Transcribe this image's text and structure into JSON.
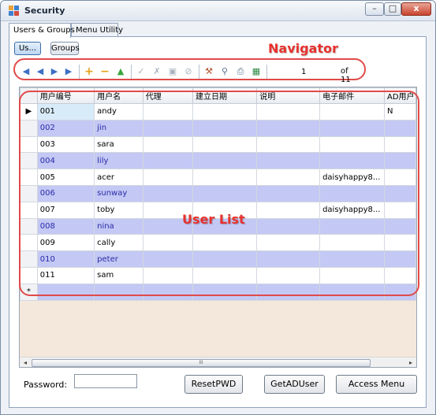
{
  "window": {
    "title": "Security",
    "min_label": "–",
    "max_label": "□",
    "close_label": "x"
  },
  "tabs": [
    {
      "label": "Users & Groups",
      "active": true
    },
    {
      "label": "Menu Utility",
      "active": false
    }
  ],
  "subtabs": [
    {
      "label": "Us...",
      "active": true
    },
    {
      "label": "Groups",
      "active": false
    }
  ],
  "annotations": {
    "navigator": "Navigator",
    "user_list": "User List"
  },
  "navigator": {
    "icons": [
      "first-icon",
      "prev-icon",
      "next-icon",
      "last-icon",
      "add-icon",
      "delete-icon",
      "up-icon",
      "check-icon",
      "cancel-icon",
      "save-icon",
      "stop-icon",
      "tool-icon",
      "find-icon",
      "print-icon",
      "export-icon"
    ],
    "position": "1",
    "of_label": "of 11"
  },
  "grid": {
    "columns": [
      "用户编号",
      "用户名",
      "代理",
      "建立日期",
      "说明",
      "电子邮件",
      "AD用户"
    ],
    "rows": [
      [
        "001",
        "andy",
        "",
        "",
        "",
        "",
        "N"
      ],
      [
        "002",
        "jin",
        "",
        "",
        "",
        "",
        ""
      ],
      [
        "003",
        "sara",
        "",
        "",
        "",
        "",
        ""
      ],
      [
        "004",
        "lily",
        "",
        "",
        "",
        "",
        ""
      ],
      [
        "005",
        "acer",
        "",
        "",
        "",
        "daisyhappy8...",
        ""
      ],
      [
        "006",
        "sunway",
        "",
        "",
        "",
        "",
        ""
      ],
      [
        "007",
        "toby",
        "",
        "",
        "",
        "daisyhappy8...",
        ""
      ],
      [
        "008",
        "nina",
        "",
        "",
        "",
        "",
        ""
      ],
      [
        "009",
        "cally",
        "",
        "",
        "",
        "",
        ""
      ],
      [
        "010",
        "peter",
        "",
        "",
        "",
        "",
        ""
      ],
      [
        "011",
        "sam",
        "",
        "",
        "",
        "",
        ""
      ]
    ],
    "current_row_marker": "▶",
    "new_row_marker": "*",
    "scroll_left": "◂",
    "scroll_right": "▸",
    "scroll_thumb": "III"
  },
  "password": {
    "label": "Password:",
    "value": ""
  },
  "buttons": {
    "reset": "ResetPWD",
    "getad": "GetADUser",
    "access": "Access Menu"
  }
}
